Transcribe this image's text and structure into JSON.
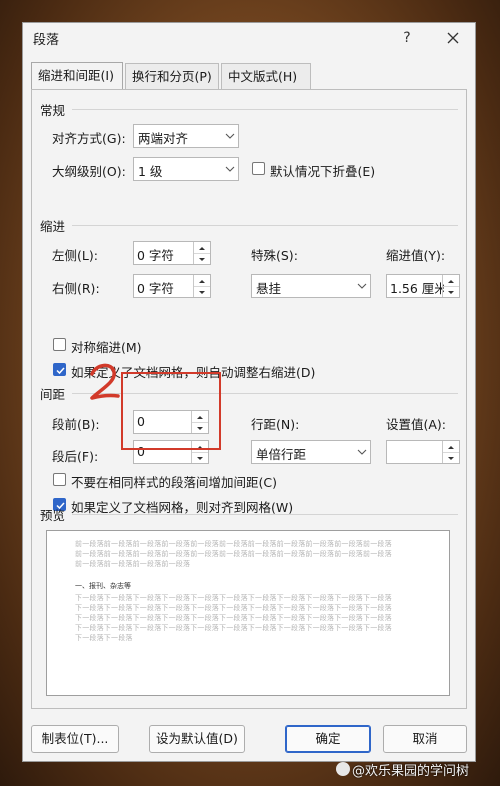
{
  "dialog": {
    "title": "段落",
    "help": "?"
  },
  "tabs": [
    {
      "label": "缩进和间距(I)"
    },
    {
      "label": "换行和分页(P)"
    },
    {
      "label": "中文版式(H)"
    }
  ],
  "general": {
    "section_label": "常规",
    "alignment_label": "对齐方式(G):",
    "alignment_value": "两端对齐",
    "outline_label": "大纲级别(O):",
    "outline_value": "1 级",
    "collapse_label": "默认情况下折叠(E)"
  },
  "indent": {
    "section_label": "缩进",
    "left_label": "左侧(L):",
    "left_value": "0 字符",
    "right_label": "右侧(R):",
    "right_value": "0 字符",
    "special_label": "特殊(S):",
    "special_value": "悬挂",
    "indent_by_label": "缩进值(Y):",
    "indent_by_value": "1.56 厘米",
    "mirror_label": "对称缩进(M)",
    "auto_adjust_label": "如果定义了文档网格，则自动调整右缩进(D)"
  },
  "spacing": {
    "section_label": "间距",
    "before_label": "段前(B):",
    "before_value": "0",
    "after_label": "段后(F):",
    "after_value": "0",
    "line_label": "行距(N):",
    "line_value": "单倍行距",
    "at_label": "设置值(A):",
    "at_value": "",
    "no_space_same_style_label": "不要在相同样式的段落间增加间距(C)",
    "snap_grid_label": "如果定义了文档网格，则对齐到网格(W)"
  },
  "preview": {
    "section_label": "预览",
    "prev_lines": [
      "前一段落前一段落前一段落前一段落前一段落前一段落前一段落前一段落前一段落前一段落前一段落",
      "前一段落前一段落前一段落前一段落前一段落前一段落前一段落前一段落前一段落前一段落前一段落",
      "前一段落前一段落前一段落前一段落"
    ],
    "sample_text": "一、报刊、杂志等",
    "next_lines": [
      "下一段落下一段落下一段落下一段落下一段落下一段落下一段落下一段落下一段落下一段落下一段落",
      "下一段落下一段落下一段落下一段落下一段落下一段落下一段落下一段落下一段落下一段落下一段落",
      "下一段落下一段落下一段落下一段落下一段落下一段落下一段落下一段落下一段落下一段落下一段落",
      "下一段落下一段落下一段落下一段落下一段落下一段落下一段落下一段落下一段落下一段落下一段落",
      "下一段落下一段落"
    ]
  },
  "buttons": {
    "tabs_label": "制表位(T)...",
    "set_default_label": "设为默认值(D)",
    "ok_label": "确定",
    "cancel_label": "取消"
  },
  "annotation": {
    "text": "2"
  },
  "watermark": {
    "text": "@欢乐果园的学问树"
  },
  "colors": {
    "accent": "#2f66c9",
    "annotation_red": "#d23a2a"
  }
}
